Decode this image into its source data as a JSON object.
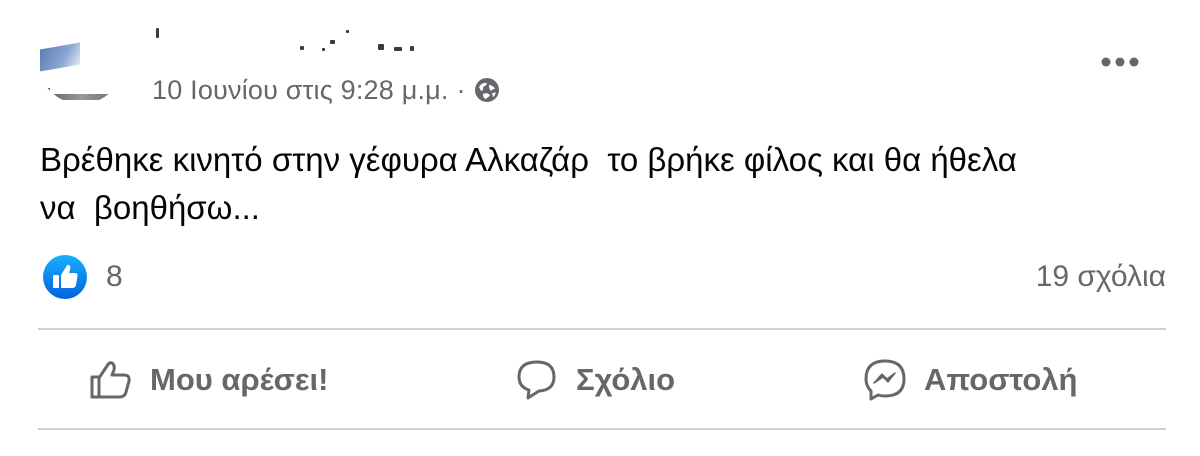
{
  "post": {
    "timestamp": "10 Ιουνίου στις 9:28 μ.μ.",
    "separator": "·",
    "audience_icon": "public-globe-icon",
    "text": "Βρέθηκε κινητό στην γέφυρα Αλκαζάρ  το βρήκε φίλος και θα ήθελα\nνα  βοηθήσω..."
  },
  "stats": {
    "reaction_icon": "like-thumb-icon",
    "reaction_count": "8",
    "comments": "19 σχόλια"
  },
  "actions": {
    "like_label": "Μου αρέσει!",
    "comment_label": "Σχόλιο",
    "send_label": "Αποστολή"
  },
  "colors": {
    "accent": "#1877f2",
    "secondary_text": "#65676b",
    "divider": "#ced0d4"
  }
}
